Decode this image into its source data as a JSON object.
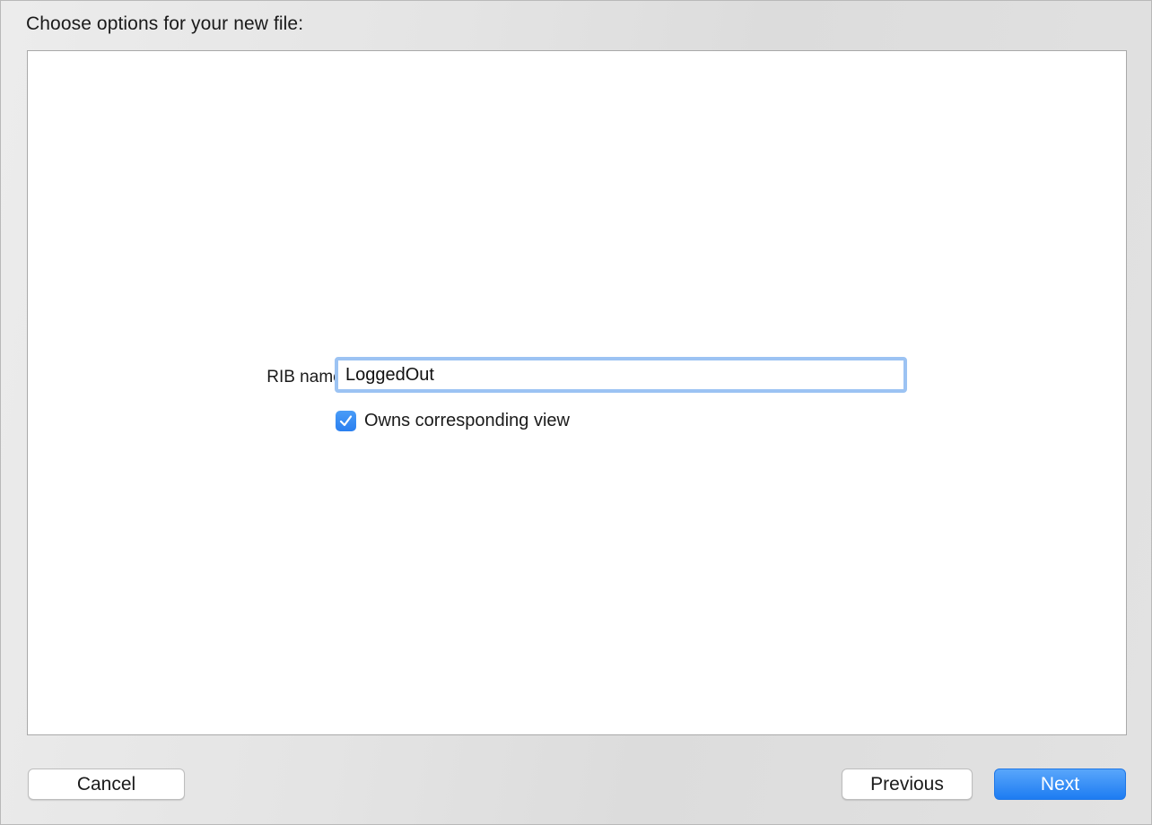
{
  "dialog": {
    "heading": "Choose options for your new file:"
  },
  "form": {
    "rib_name_label": "RIB name:",
    "rib_name_value": "LoggedOut",
    "owns_view_label": "Owns corresponding view",
    "owns_view_checked": true
  },
  "buttons": {
    "cancel": "Cancel",
    "previous": "Previous",
    "next": "Next"
  },
  "colors": {
    "accent": "#1d7cf2",
    "focus_ring": "#9cc3f3"
  },
  "icons": {
    "checkbox": "checkmark-icon"
  }
}
